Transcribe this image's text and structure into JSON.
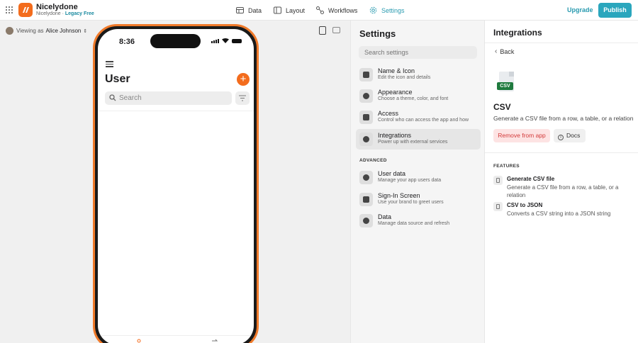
{
  "app": {
    "name": "Nicelydone",
    "workspace": "Nicelydone",
    "separator": "·",
    "plan": "Legacy Free"
  },
  "nav": [
    {
      "label": "Data",
      "icon": "table-icon"
    },
    {
      "label": "Layout",
      "icon": "layout-icon"
    },
    {
      "label": "Workflows",
      "icon": "workflows-icon"
    },
    {
      "label": "Settings",
      "icon": "gear-icon",
      "active": true
    }
  ],
  "header": {
    "upgrade_label": "Upgrade",
    "publish_label": "Publish"
  },
  "canvas": {
    "viewing_prefix": "Viewing as",
    "viewing_user": "Alice Johnson"
  },
  "phone": {
    "time": "8:36",
    "title": "User",
    "search_placeholder": "Search",
    "fab_label": "+"
  },
  "settings": {
    "title": "Settings",
    "search_placeholder": "Search settings",
    "items": [
      {
        "title": "Name & Icon",
        "desc": "Edit the icon and details"
      },
      {
        "title": "Appearance",
        "desc": "Choose a theme, color, and font"
      },
      {
        "title": "Access",
        "desc": "Control who can access the app and how"
      },
      {
        "title": "Integrations",
        "desc": "Power up with external services",
        "active": true
      }
    ],
    "advanced_label": "ADVANCED",
    "advanced_items": [
      {
        "title": "User data",
        "desc": "Manage your app users data"
      },
      {
        "title": "Sign-In Screen",
        "desc": "Use your brand to greet users"
      },
      {
        "title": "Data",
        "desc": "Manage data source and refresh"
      }
    ]
  },
  "integrations": {
    "title": "Integrations",
    "back_label": "Back",
    "file_badge": "CSV",
    "name": "CSV",
    "description": "Generate a CSV file from a row, a table, or a relation",
    "remove_label": "Remove from app",
    "docs_label": "Docs",
    "features_label": "FEATURES",
    "features": [
      {
        "title": "Generate CSV file",
        "desc": "Generate a CSV file from a row, a table, or a relation"
      },
      {
        "title": "CSV to JSON",
        "desc": "Converts a CSV string into a JSON string"
      }
    ]
  },
  "colors": {
    "accent": "#2aa6bd",
    "brand": "#f36c1d",
    "danger": "#d33a3a"
  }
}
